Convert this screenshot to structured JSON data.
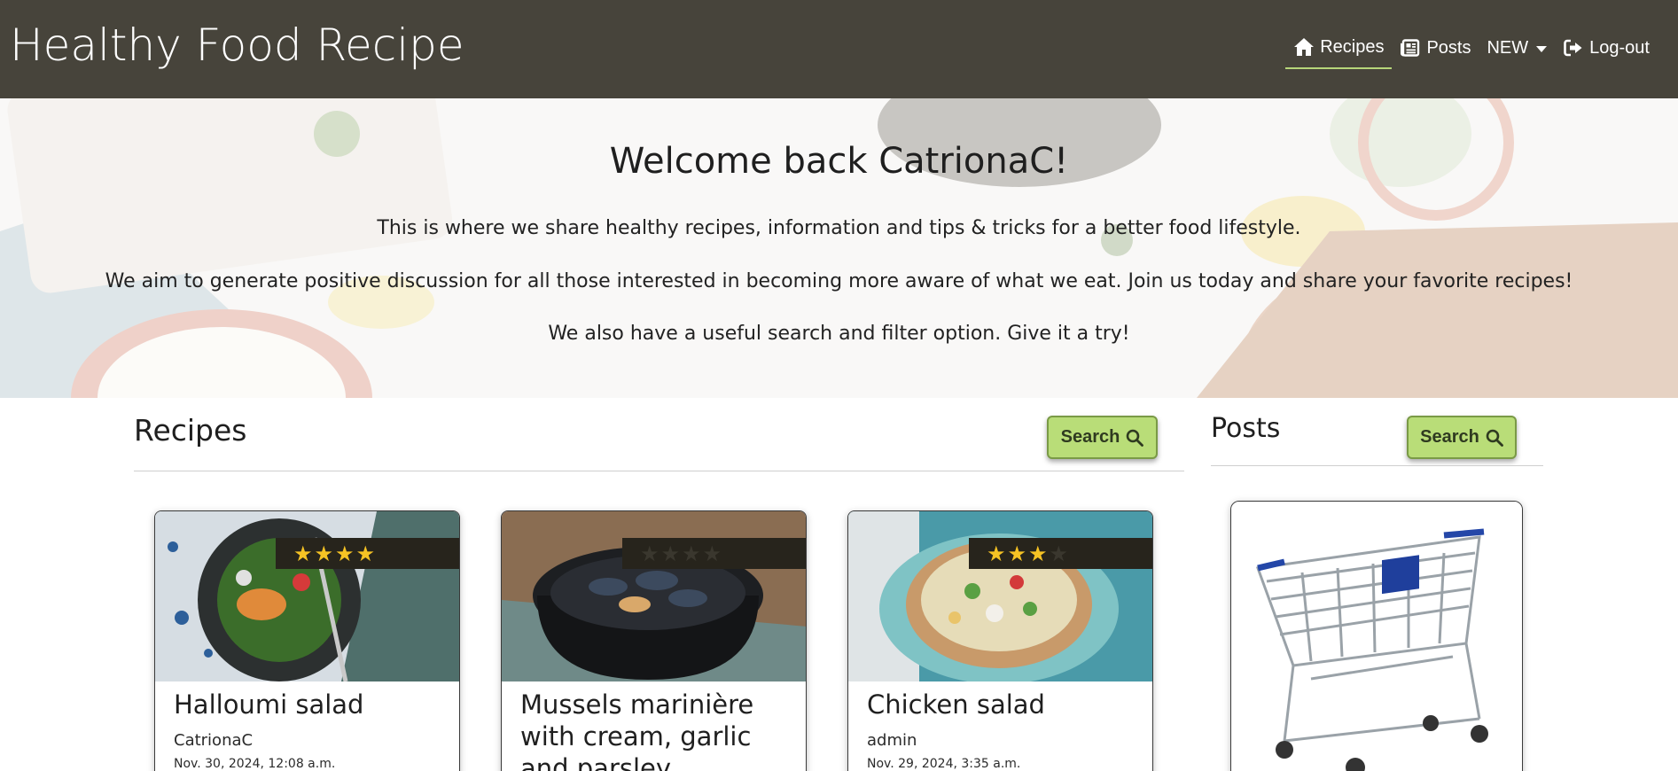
{
  "navbar": {
    "brand": "Healthy Food Recipe",
    "items": [
      {
        "label": "Recipes",
        "icon": "home-icon",
        "active": true
      },
      {
        "label": "Posts",
        "icon": "newspaper-icon",
        "active": false
      },
      {
        "label": "NEW",
        "icon": "chevron-down-icon",
        "active": false
      },
      {
        "label": "Log-out",
        "icon": "logout-icon",
        "active": false
      }
    ]
  },
  "hero": {
    "title": "Welcome back CatrionaC!",
    "lines": [
      "This is where we share healthy recipes, information and tips & tricks for a better food lifestyle.",
      "We aim to generate positive discussion for all those interested in becoming more aware of what we eat. Join us today and share your favorite recipes!",
      "We also have a useful search and filter option. Give it a try!"
    ]
  },
  "recipes_section": {
    "title": "Recipes",
    "search_label": "Search"
  },
  "posts_section": {
    "title": "Posts",
    "search_label": "Search"
  },
  "recipes": [
    {
      "title": "Halloumi salad",
      "author": "CatrionaC",
      "date": "Nov. 30, 2024, 12:08 a.m.",
      "rating": 4
    },
    {
      "title": "Mussels marinière with cream, garlic and parsley",
      "author": "",
      "date": "",
      "rating": 0
    },
    {
      "title": "Chicken salad",
      "author": "admin",
      "date": "Nov. 29, 2024, 3:35 a.m.",
      "rating": 3
    }
  ],
  "colors": {
    "navbar": "#47443b",
    "accent_green": "#b9dd78",
    "star": "#f6c324",
    "rating_bar": "#27241c"
  }
}
